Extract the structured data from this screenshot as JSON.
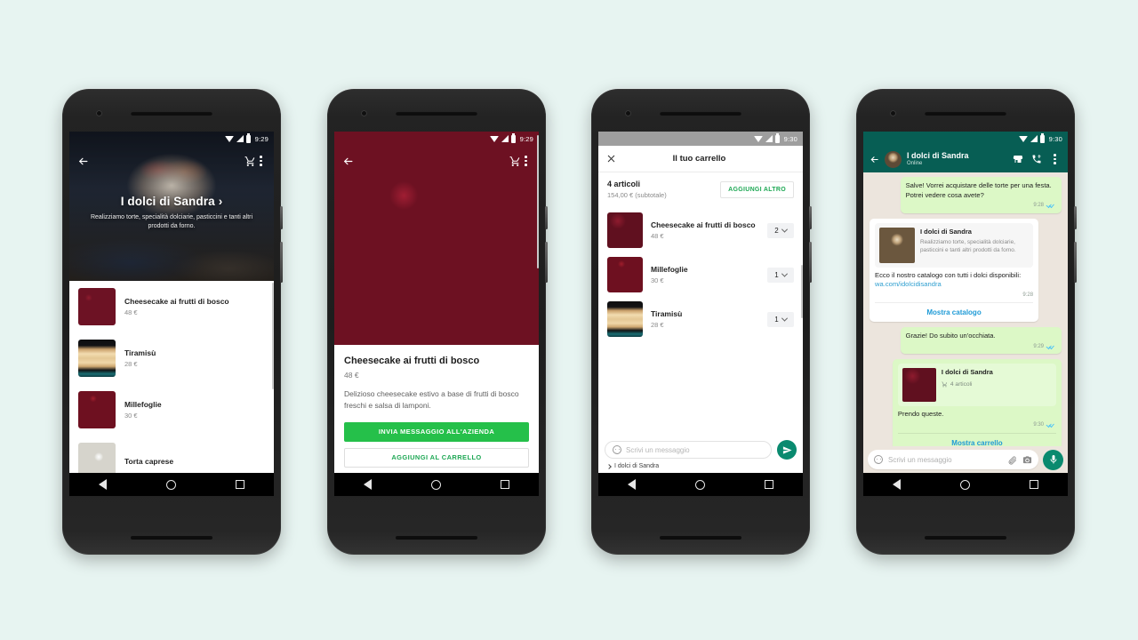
{
  "background_color": "#e7f4f1",
  "brand": {
    "name": "I dolci di Sandra",
    "tagline": "Realizziamo torte, specialità dolciarie, pasticcini e tanti altri prodotti da forno.",
    "accent_green": "#25c04a",
    "link_green": "#1fa855",
    "whatsapp_teal": "#075e54",
    "send_teal": "#0a8a6f"
  },
  "phone1": {
    "status": {
      "time": "9:29"
    },
    "header": {
      "title": "I dolci di Sandra",
      "chevron": "›",
      "subtitle": "Realizziamo torte, specialità dolciarie, pasticcini e tanti altri prodotti da forno."
    },
    "icons": {
      "back": "back-arrow-icon",
      "cart": "shopping-cart-icon",
      "menu": "overflow-menu-icon"
    },
    "products": [
      {
        "name": "Cheesecake ai frutti di bosco",
        "price": "48 €"
      },
      {
        "name": "Tiramisù",
        "price": "28 €"
      },
      {
        "name": "Millefoglie",
        "price": "30 €"
      },
      {
        "name": "Torta caprese",
        "price": ""
      }
    ]
  },
  "phone2": {
    "status": {
      "time": "9:29"
    },
    "detail": {
      "title": "Cheesecake ai frutti di bosco",
      "price": "48 €",
      "description": "Delizioso cheesecake estivo a base di frutti di bosco freschi e salsa di lamponi.",
      "primary_button": "INVIA MESSAGGIO ALL'AZIENDA",
      "secondary_button": "AGGIUNGI AL CARRELLO"
    }
  },
  "phone3": {
    "status": {
      "time": "9:30"
    },
    "header": {
      "title": "Il tuo carrello",
      "close": "close-icon"
    },
    "summary": {
      "count": "4 articoli",
      "subtotal": "154,00 € (subtotale)",
      "add_more": "AGGIUNGI ALTRO"
    },
    "items": [
      {
        "name": "Cheesecake ai frutti di bosco",
        "price": "48 €",
        "qty": "2"
      },
      {
        "name": "Millefoglie",
        "price": "30 €",
        "qty": "1"
      },
      {
        "name": "Tiramisù",
        "price": "28 €",
        "qty": "1"
      }
    ],
    "input": {
      "placeholder": "Scrivi un messaggio",
      "footer": "I dolci di Sandra"
    }
  },
  "phone4": {
    "status": {
      "time": "9:30"
    },
    "header": {
      "name": "I dolci di Sandra",
      "status": "Online"
    },
    "messages": [
      {
        "dir": "out",
        "text": "Salve! Vorrei acquistare delle torte per una festa. Potrei vedere cosa avete?",
        "time": "9:28"
      },
      {
        "dir": "in",
        "card_title": "I dolci di Sandra",
        "card_desc": "Realizziamo torte, specialità dolciarie, pasticcini e tanti altri prodotti da forno.",
        "text": "Ecco il nostro catalogo con tutti i dolci disponibili:",
        "link": "wa.com/idolcidisandra",
        "time": "9:28",
        "action": "Mostra catalogo"
      },
      {
        "dir": "out",
        "text": "Grazie! Do subito un'occhiata.",
        "time": "9:29"
      },
      {
        "dir": "out",
        "card_title": "I dolci di Sandra",
        "card_sub": "4 articoli",
        "text": "Prendo queste.",
        "time": "9:30",
        "action": "Mostra carrello"
      }
    ],
    "input": {
      "placeholder": "Scrivi un messaggio",
      "icons": [
        "emoji-icon",
        "attachment-icon",
        "camera-icon",
        "microphone-icon"
      ]
    }
  }
}
